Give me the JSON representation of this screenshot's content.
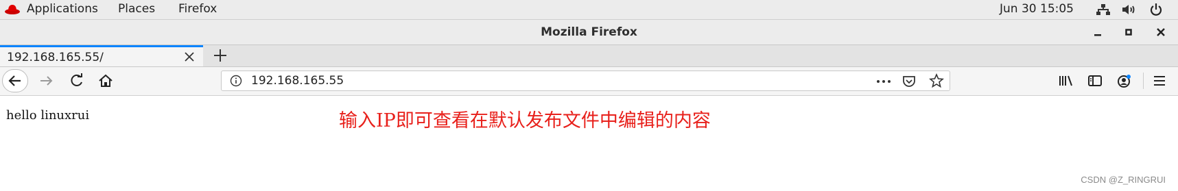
{
  "desktop": {
    "menu_items": [
      "Applications",
      "Places",
      "Firefox"
    ],
    "datetime": "Jun 30  15:05",
    "icons": [
      "redhat-logo-icon",
      "network-icon",
      "volume-icon",
      "power-icon"
    ]
  },
  "window": {
    "title": "Mozilla Firefox",
    "controls": [
      "minimize",
      "maximize",
      "close"
    ]
  },
  "tabs": [
    {
      "label": "192.168.165.55/",
      "active": true
    }
  ],
  "navbar": {
    "url": "192.168.165.55",
    "icons": [
      "back-icon",
      "forward-icon",
      "reload-icon",
      "home-icon",
      "info-icon",
      "more-actions-icon",
      "pocket-icon",
      "bookmark-star-icon",
      "library-icon",
      "sidebar-icon",
      "account-icon",
      "hamburger-menu-icon"
    ]
  },
  "page": {
    "body_text": "hello linuxrui"
  },
  "annotation": {
    "text": "输入IP即可查看在默认发布文件中编辑的内容",
    "color": "#e8201b"
  },
  "watermark": "CSDN @Z_RINGRUI",
  "colors": {
    "tab_accent": "#0a84ff"
  }
}
